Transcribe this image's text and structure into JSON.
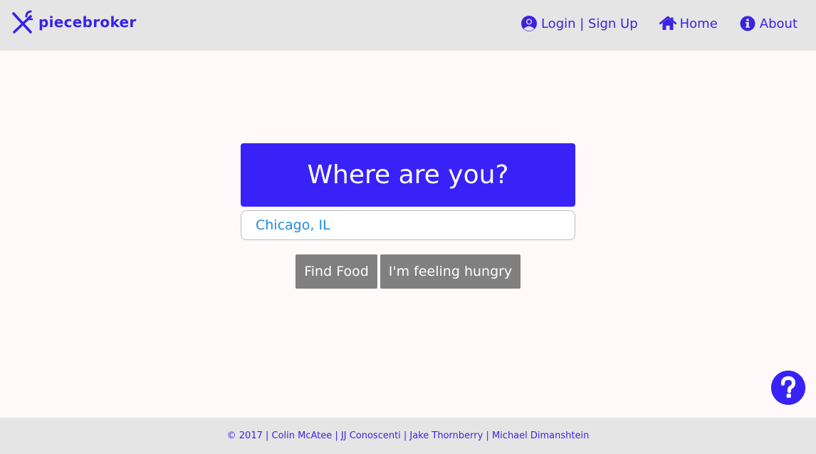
{
  "nav": {
    "brand": "piecebroker",
    "links": [
      {
        "label": "Login | Sign Up",
        "icon": "user-circle-icon"
      },
      {
        "label": "Home",
        "icon": "home-icon"
      },
      {
        "label": "About",
        "icon": "info-circle-icon"
      }
    ]
  },
  "hero": {
    "title": "Where are you?"
  },
  "location": {
    "value": "Chicago, IL"
  },
  "buttons": {
    "find": "Find Food",
    "hungry": "I'm feeling hungry"
  },
  "help": {
    "icon": "question-icon"
  },
  "footer": {
    "text": "© 2017 | Colin McAtee | JJ Conoscenti | Jake Thornberry | Michael Dimanshtein"
  },
  "colors": {
    "accent": "#3822f7",
    "nav_bg": "#e5e5e5",
    "page_bg": "#fffaf9",
    "button_gray": "#808080",
    "input_text": "#1f8be0"
  }
}
